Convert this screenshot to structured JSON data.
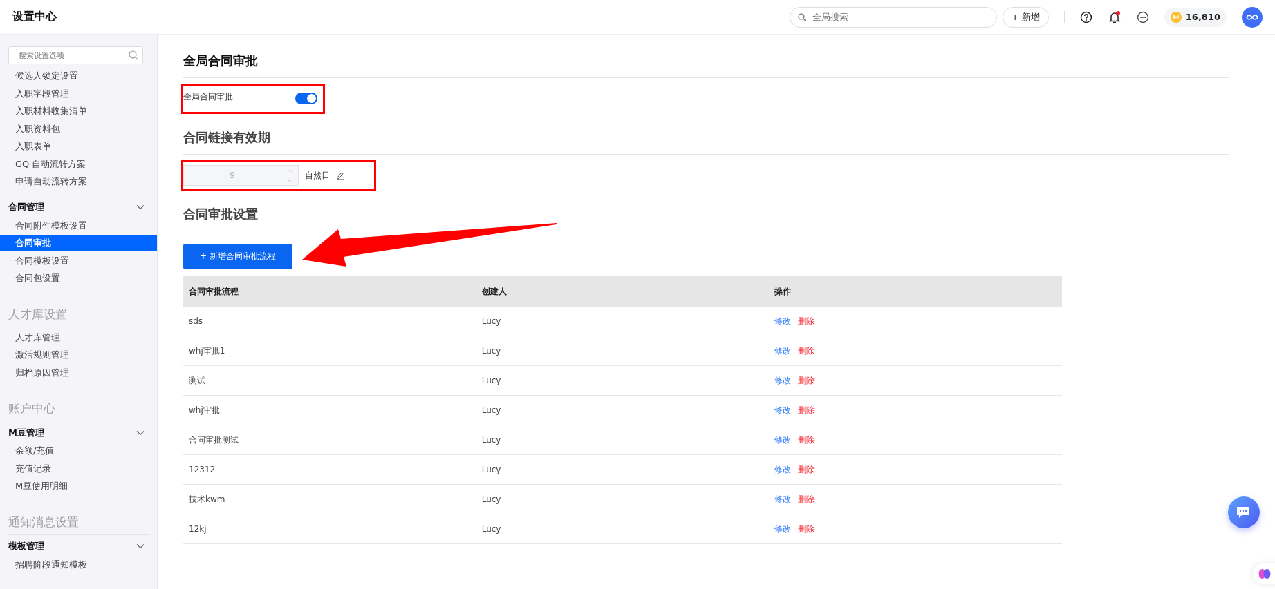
{
  "header": {
    "title": "设置中心",
    "search": {
      "placeholder": "全局搜索"
    },
    "new_button": "+ 新增",
    "unread": true,
    "coins": "16,810"
  },
  "sidebar": {
    "search": {
      "placeholder": "搜索设置选项"
    },
    "sections": [
      {
        "groups": [
          {
            "items": [
              {
                "label": "候选人锁定设置",
                "selected": false
              },
              {
                "label": "入职字段管理",
                "selected": false
              },
              {
                "label": "入职材料收集清单",
                "selected": false
              },
              {
                "label": "入职资料包",
                "selected": false
              },
              {
                "label": "入职表单",
                "selected": false
              },
              {
                "label": "GQ 自动流转方案",
                "selected": false
              },
              {
                "label": "申请自动流转方案",
                "selected": false
              }
            ]
          },
          {
            "label": "合同管理",
            "expanded": true,
            "items": [
              {
                "label": "合同附件模板设置",
                "selected": false
              },
              {
                "label": "合同审批",
                "selected": true
              },
              {
                "label": "合同模板设置",
                "selected": false
              },
              {
                "label": "合同包设置",
                "selected": false
              }
            ]
          }
        ]
      },
      {
        "title": "人才库设置",
        "groups": [
          {
            "items": [
              {
                "label": "人才库管理",
                "selected": false
              },
              {
                "label": "激活规则管理",
                "selected": false
              },
              {
                "label": "归档原因管理",
                "selected": false
              }
            ]
          }
        ]
      },
      {
        "title": "账户中心",
        "groups": [
          {
            "label": "M豆管理",
            "expanded": true,
            "items": [
              {
                "label": "余额/充值",
                "selected": false
              },
              {
                "label": "充值记录",
                "selected": false
              },
              {
                "label": "M豆使用明细",
                "selected": false
              }
            ]
          }
        ]
      },
      {
        "title": "通知消息设置",
        "groups": [
          {
            "label": "模板管理",
            "expanded": true,
            "items": [
              {
                "label": "招聘阶段通知模板",
                "selected": false
              }
            ]
          }
        ]
      }
    ]
  },
  "main": {
    "global_approval": {
      "title": "全局合同审批",
      "label": "全局合同审批",
      "on": true,
      "highlighted": true
    },
    "link_validity": {
      "title": "合同链接有效期",
      "value": "9",
      "disabled": true,
      "unit": "自然日",
      "highlighted": true
    },
    "approval_settings": {
      "title": "合同审批设置",
      "add_button": "+ 新增合同审批流程",
      "table": {
        "columns": [
          "合同审批流程",
          "创建人",
          "操作"
        ],
        "rows": [
          {
            "name": "sds",
            "creator": "Lucy",
            "actions": [
              {
                "label": "修改",
                "kind": "edit"
              },
              {
                "label": "删除",
                "kind": "delete"
              }
            ]
          },
          {
            "name": "whj审批1",
            "creator": "Lucy",
            "actions": [
              {
                "label": "修改",
                "kind": "edit"
              },
              {
                "label": "删除",
                "kind": "delete"
              }
            ]
          },
          {
            "name": "测试",
            "creator": "Lucy",
            "actions": [
              {
                "label": "修改",
                "kind": "edit"
              },
              {
                "label": "删除",
                "kind": "delete"
              }
            ]
          },
          {
            "name": "whj审批",
            "creator": "Lucy",
            "actions": [
              {
                "label": "修改",
                "kind": "edit"
              },
              {
                "label": "删除",
                "kind": "delete"
              }
            ]
          },
          {
            "name": "合同审批测试",
            "creator": "Lucy",
            "actions": [
              {
                "label": "修改",
                "kind": "edit"
              },
              {
                "label": "删除",
                "kind": "delete"
              }
            ]
          },
          {
            "name": "12312",
            "creator": "Lucy",
            "actions": [
              {
                "label": "修改",
                "kind": "edit"
              },
              {
                "label": "删除",
                "kind": "delete"
              }
            ]
          },
          {
            "name": "技术kwm",
            "creator": "Lucy",
            "actions": [
              {
                "label": "修改",
                "kind": "edit"
              },
              {
                "label": "删除",
                "kind": "delete"
              }
            ]
          },
          {
            "name": "12kj",
            "creator": "Lucy",
            "actions": [
              {
                "label": "修改",
                "kind": "edit"
              },
              {
                "label": "删除",
                "kind": "delete"
              }
            ]
          }
        ]
      }
    }
  }
}
